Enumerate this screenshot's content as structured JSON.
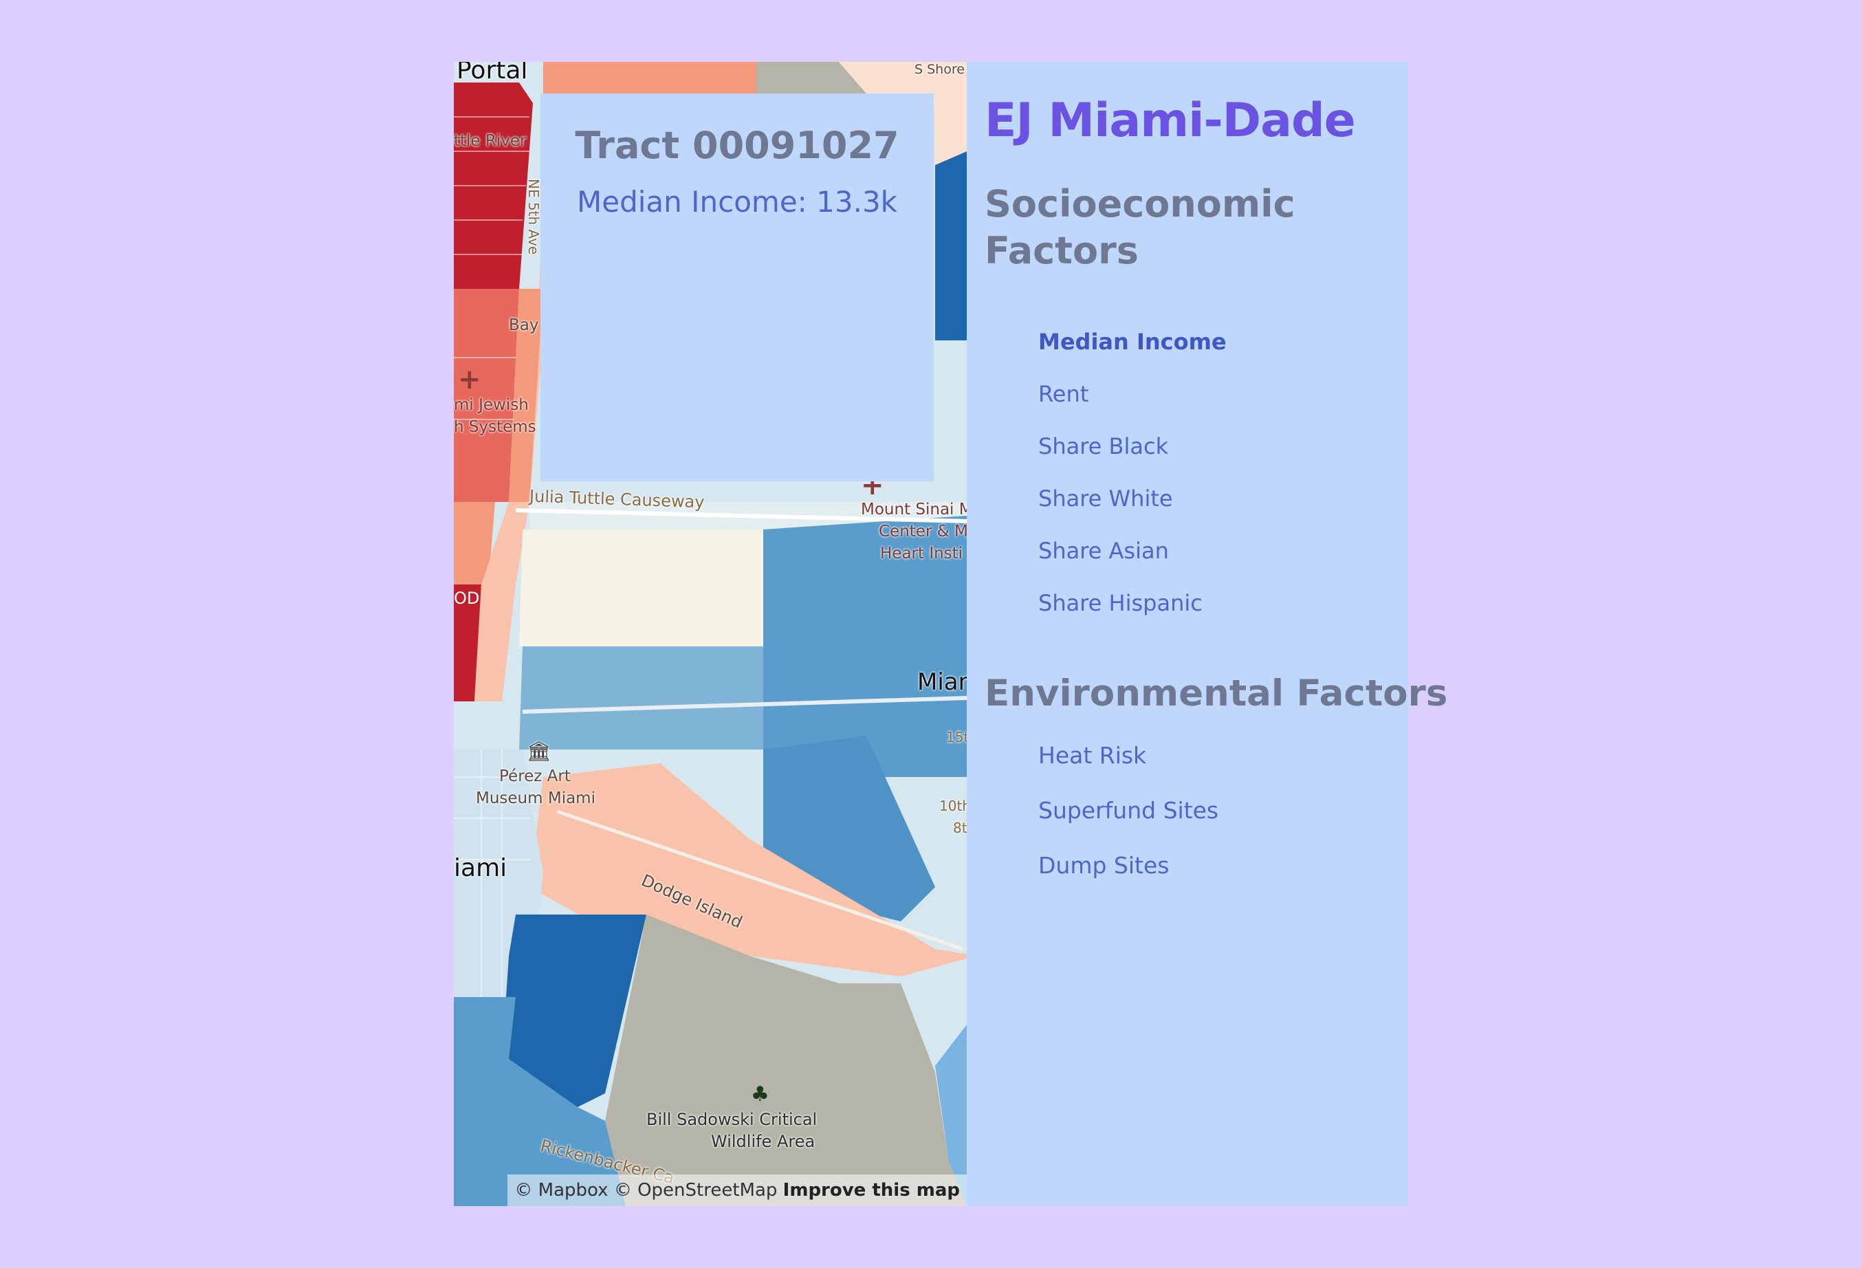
{
  "app": {
    "title": "EJ Miami-Dade"
  },
  "tooltip": {
    "tract_label": "Tract 00091027",
    "metric_text": "Median Income: 13.3k"
  },
  "sidebar": {
    "socioeconomic": {
      "heading": "Socioeconomic Factors",
      "items": [
        {
          "label": "Median Income",
          "selected": true
        },
        {
          "label": "Rent"
        },
        {
          "label": "Share Black"
        },
        {
          "label": "Share White"
        },
        {
          "label": "Share Asian"
        },
        {
          "label": "Share Hispanic"
        }
      ]
    },
    "environmental": {
      "heading": "Environmental Factors",
      "items": [
        {
          "label": "Heat Risk"
        },
        {
          "label": "Superfund Sites"
        },
        {
          "label": "Dump Sites"
        }
      ]
    }
  },
  "map": {
    "labels": {
      "portal": "Portal",
      "little_river": "ttle River",
      "ne_5th_ave": "NE 5th Ave",
      "bay": "Bay",
      "jewish_health_1": "mi Jewish",
      "jewish_health_2": "h Systems",
      "s_shore": "S Shore",
      "julia_tuttle": "Julia Tuttle Causeway",
      "mount_sinai_1": "Mount Sinai M",
      "mount_sinai_2": "Center & M",
      "mount_sinai_3": "Heart Insti",
      "miami_beach": "Mian",
      "od": "OD",
      "perez_1": "Pérez Art",
      "perez_2": "Museum Miami",
      "miami": "iami",
      "dodge_island": "Dodge Island",
      "st_15": "15t",
      "st_10": "10th",
      "st_8": "8t",
      "bill_sadowski_1": "Bill Sadowski Critical",
      "bill_sadowski_2": "Wildlife Area",
      "rickenbacker": "Rickenbacker Ca"
    },
    "attribution": {
      "mapbox": "© Mapbox",
      "osm": "© OpenStreetMap",
      "improve": "Improve this map"
    },
    "colors": {
      "dark_red": "#c0202e",
      "red": "#e7685d",
      "salmon": "#f49a7c",
      "peach": "#f8c3aa",
      "light_peach": "#fbe1d2",
      "cream": "#f6f3e6",
      "light_blue": "#d6e7f0",
      "mid_blue": "#7fb4d6",
      "blue": "#5a9ccb",
      "dark_blue": "#1e67ad",
      "gray": "#b5b4a8"
    }
  }
}
